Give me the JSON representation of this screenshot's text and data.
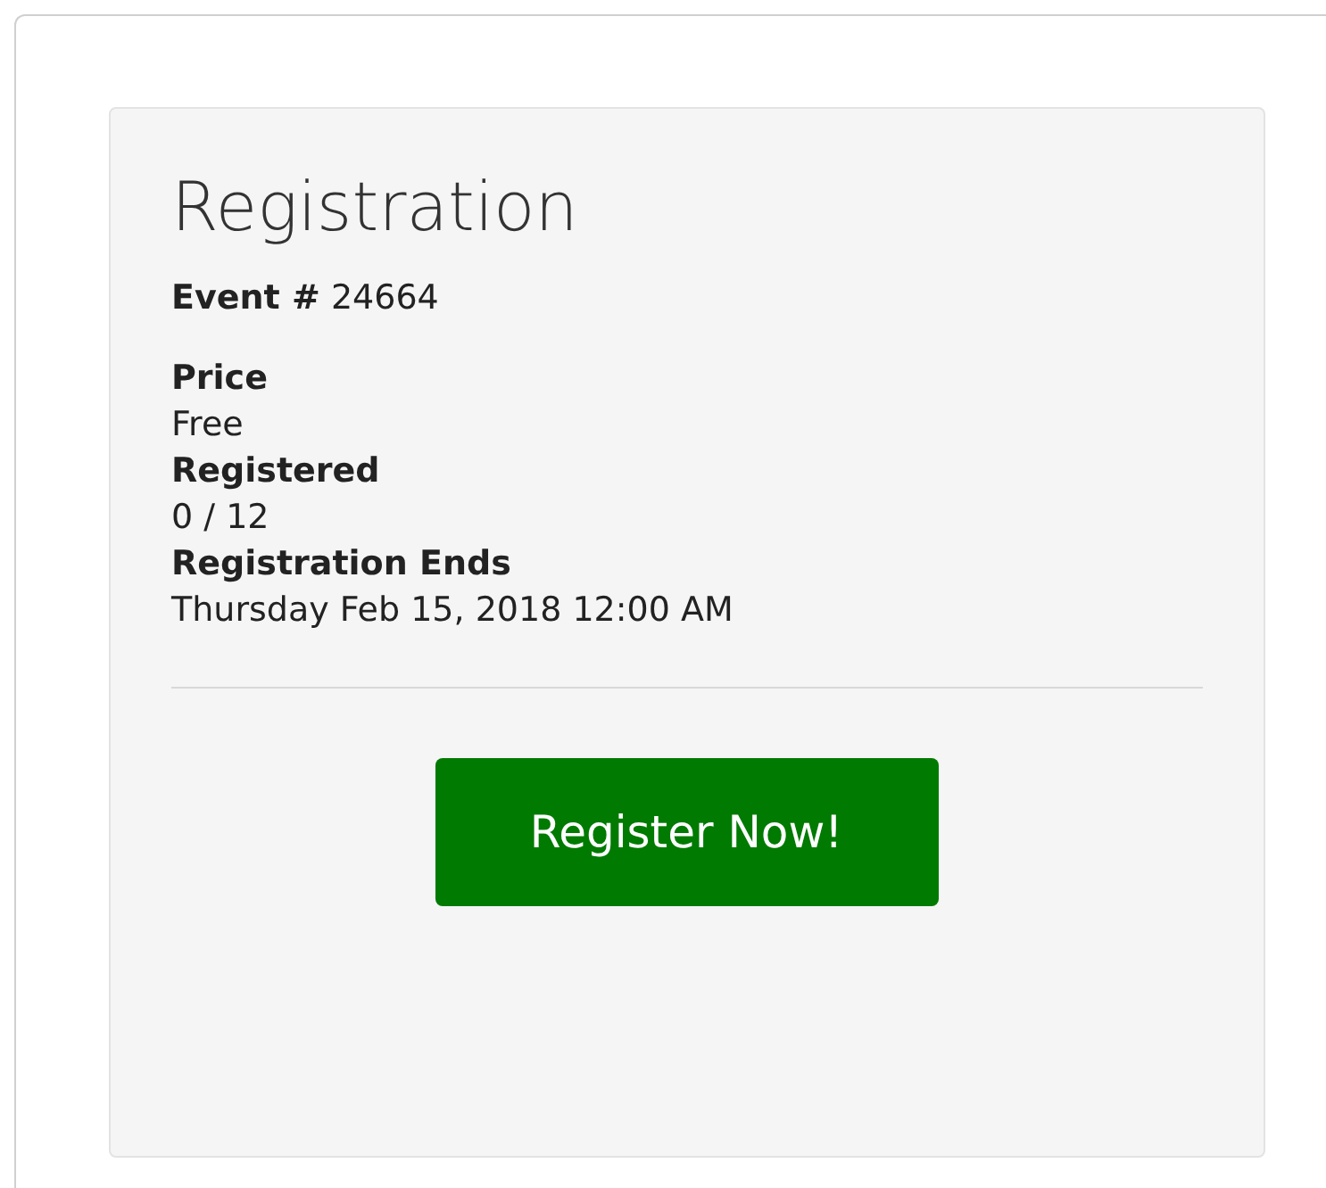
{
  "card": {
    "title": "Registration",
    "event": "**Event #** 24664",
    "fields": [
      {
        "label": "Price",
        "value": "Free"
      },
      {
        "label": "Registered",
        "value": "0 / 12"
      },
      {
        "label": "Registration Ends",
        "value": "Thursday Feb 15, 2018 12:00 AM"
      }
    ],
    "button": "Register Now!"
  }
}
